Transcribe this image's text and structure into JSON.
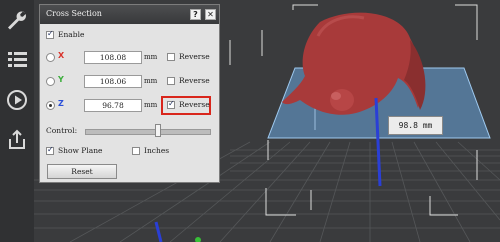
{
  "panel": {
    "title": "Cross Section",
    "help_label": "?",
    "close_label": "✕",
    "enable_label": "Enable",
    "axes": [
      {
        "name": "X",
        "value": "108.08",
        "unit": "mm",
        "reverse_label": "Reverse",
        "selected": false,
        "reversed": false,
        "color": "#d9322a"
      },
      {
        "name": "Y",
        "value": "108.06",
        "unit": "mm",
        "reverse_label": "Reverse",
        "selected": false,
        "reversed": false,
        "color": "#3cae3c"
      },
      {
        "name": "Z",
        "value": "96.78",
        "unit": "mm",
        "reverse_label": "Reverse",
        "selected": true,
        "reversed": true,
        "color": "#2a4fd9"
      }
    ],
    "control_label": "Control:",
    "slider_value": 0.58,
    "show_plane_label": "Show Plane",
    "inches_label": "Inches",
    "reset_label": "Reset"
  },
  "viewport": {
    "measure_label": "98.8 mm"
  },
  "toolbar": {
    "icons": [
      "wrench-icon",
      "list-icon",
      "play-icon",
      "export-icon"
    ]
  },
  "colors": {
    "accent_highlight": "#d9261c",
    "model": "#a83a3a",
    "plane": "#6aa7e0"
  }
}
